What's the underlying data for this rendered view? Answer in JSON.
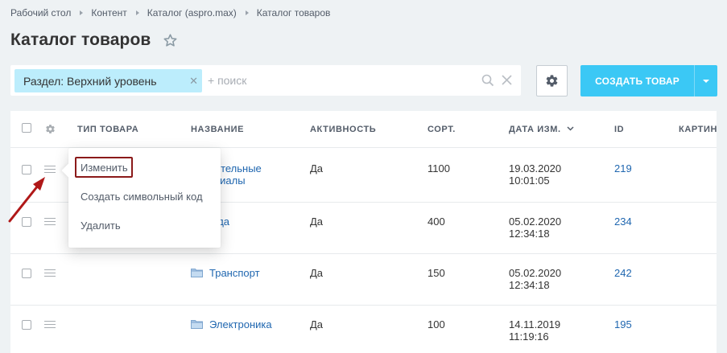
{
  "breadcrumb": [
    "Рабочий стол",
    "Контент",
    "Каталог (aspro.max)",
    "Каталог товаров"
  ],
  "page": {
    "title": "Каталог товаров"
  },
  "filter": {
    "tag_label": "Раздел: Верхний уровень",
    "search_placeholder": "+ поиск"
  },
  "toolbar": {
    "create_label": "СОЗДАТЬ ТОВАР"
  },
  "grid": {
    "columns": [
      "ТИП ТОВАРА",
      "НАЗВАНИЕ",
      "АКТИВНОСТЬ",
      "СОРТ.",
      "ДАТА ИЗМ.",
      "ID",
      "КАРТИН"
    ],
    "rows": [
      {
        "name_line1": "Строительные",
        "name_line2": "материалы",
        "active": "Да",
        "sort": "1100",
        "date": "19.03.2020",
        "time": "10:01:05",
        "id": "219"
      },
      {
        "name_line1": "Одежда",
        "name_line2": "",
        "active": "Да",
        "sort": "400",
        "date": "05.02.2020",
        "time": "12:34:18",
        "id": "234"
      },
      {
        "name_line1": "Транспорт",
        "name_line2": "",
        "active": "Да",
        "sort": "150",
        "date": "05.02.2020",
        "time": "12:34:18",
        "id": "242"
      },
      {
        "name_line1": "Электроника",
        "name_line2": "",
        "active": "Да",
        "sort": "100",
        "date": "14.11.2019",
        "time": "11:19:16",
        "id": "195"
      }
    ]
  },
  "context_menu": {
    "items": [
      "Изменить",
      "Создать символьный код",
      "Удалить"
    ]
  },
  "colors": {
    "accent": "#3bc8f5",
    "link": "#2067b0",
    "tag_bg": "#bcedfc",
    "highlight": "#8b1a1a"
  }
}
